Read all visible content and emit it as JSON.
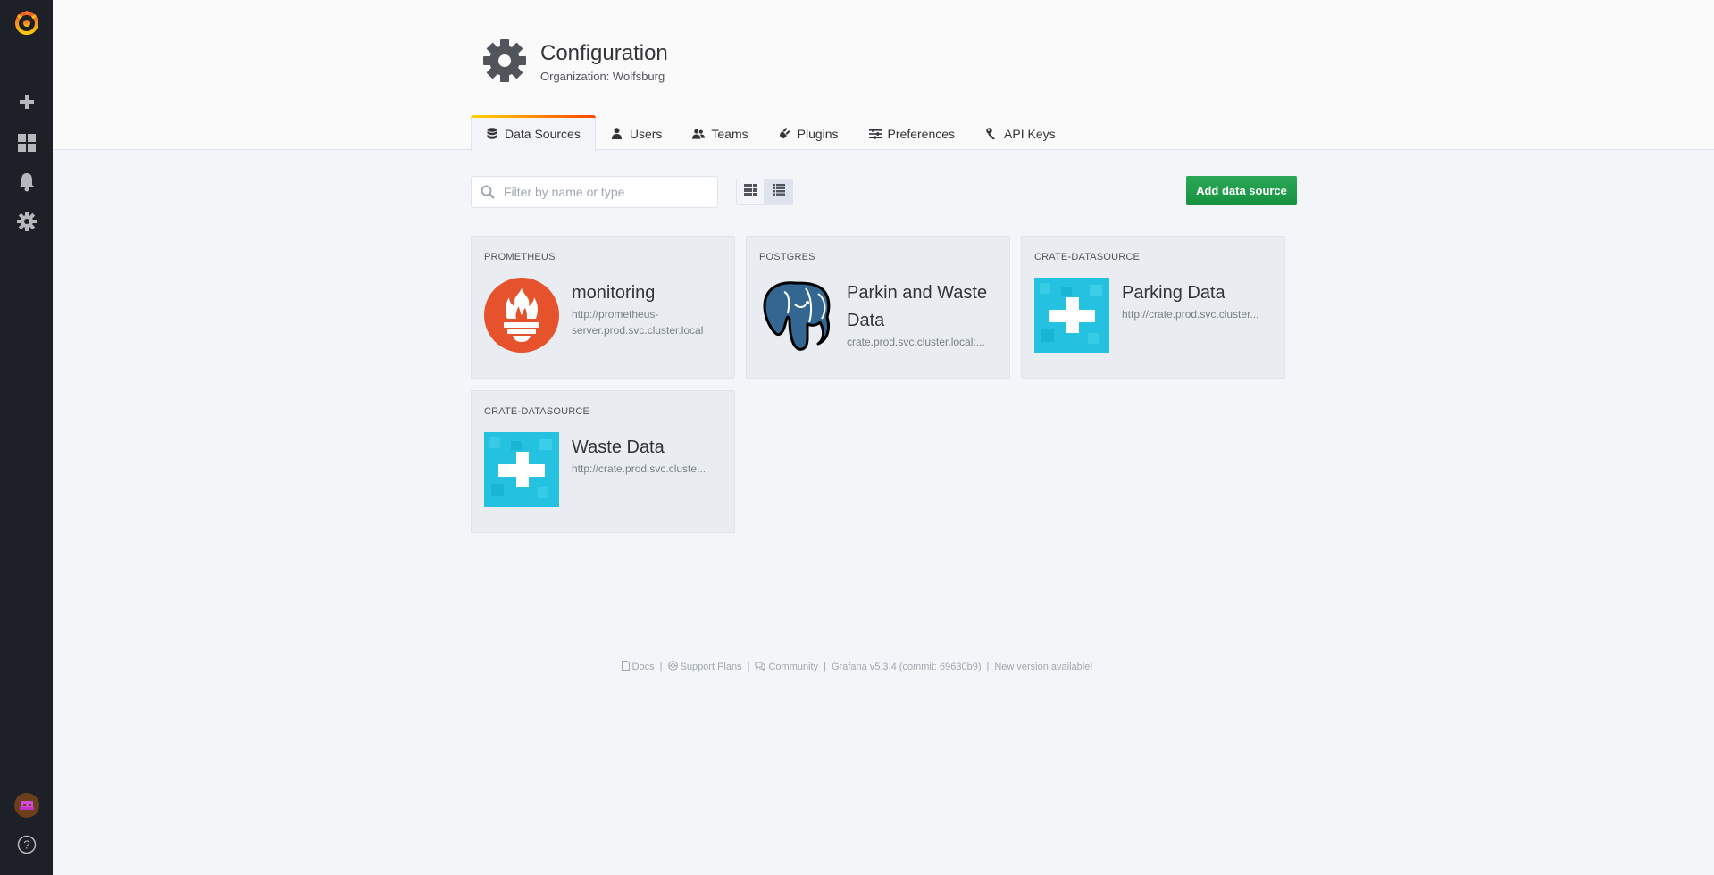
{
  "header": {
    "title": "Configuration",
    "subtitle": "Organization: Wolfsburg"
  },
  "tabs": [
    {
      "label": "Data Sources",
      "icon": "database-icon",
      "active": true
    },
    {
      "label": "Users",
      "icon": "user-icon"
    },
    {
      "label": "Teams",
      "icon": "users-icon"
    },
    {
      "label": "Plugins",
      "icon": "plug-icon"
    },
    {
      "label": "Preferences",
      "icon": "sliders-icon"
    },
    {
      "label": "API Keys",
      "icon": "key-icon"
    }
  ],
  "toolbar": {
    "search_placeholder": "Filter by name or type",
    "add_label": "Add data source"
  },
  "datasources": [
    {
      "type": "PROMETHEUS",
      "name": "monitoring",
      "url": "http://prometheus-server.prod.svc.cluster.local"
    },
    {
      "type": "POSTGRES",
      "name": "Parkin and Waste Data",
      "url": "crate.prod.svc.cluster.local:..."
    },
    {
      "type": "CRATE-DATASOURCE",
      "name": "Parking Data",
      "url": "http://crate.prod.svc.cluster..."
    },
    {
      "type": "CRATE-DATASOURCE",
      "name": "Waste Data",
      "url": "http://crate.prod.svc.cluste..."
    }
  ],
  "footer": {
    "docs": "Docs",
    "support": "Support Plans",
    "community": "Community",
    "version": "Grafana v5.3.4 (commit: 69630b9)",
    "update": "New version available!"
  },
  "colors": {
    "sidebar_bg": "#1e2028",
    "accent_green": "#1c9b46",
    "prometheus_red": "#e6522c",
    "postgres_blue": "#336791",
    "crate_cyan": "#24c2e0"
  }
}
